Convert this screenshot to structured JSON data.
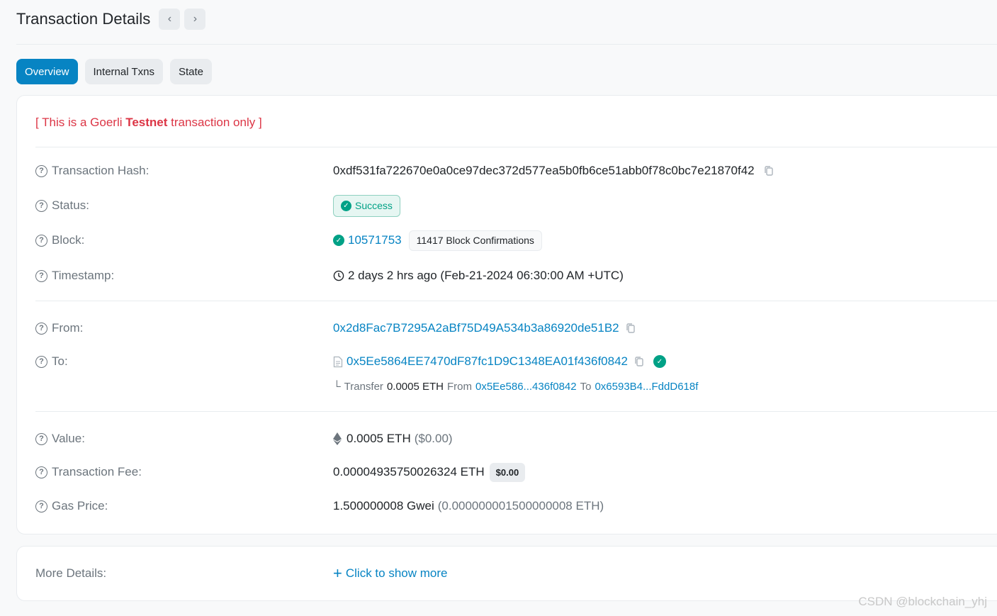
{
  "header": {
    "title": "Transaction Details",
    "prev": "‹",
    "next": "›"
  },
  "tabs": [
    {
      "label": "Overview",
      "active": true
    },
    {
      "label": "Internal Txns",
      "active": false
    },
    {
      "label": "State",
      "active": false
    }
  ],
  "notice": {
    "prefix": "[ This is a Goerli ",
    "bold": "Testnet",
    "suffix": " transaction only ]"
  },
  "details": {
    "hash_label": "Transaction Hash:",
    "hash": "0xdf531fa722670e0a0ce97dec372d577ea5b0fb6ce51abb0f78c0bc7e21870f42",
    "status_label": "Status:",
    "status": "Success",
    "block_label": "Block:",
    "block": "10571753",
    "confirmations": "11417 Block Confirmations",
    "timestamp_label": "Timestamp:",
    "timestamp": "2 days 2 hrs ago (Feb-21-2024 06:30:00 AM +UTC)",
    "from_label": "From:",
    "from": "0x2d8Fac7B7295A2aBf75D49A534b3a86920de51B2",
    "to_label": "To:",
    "to": "0x5Ee5864EE7470dF87fc1D9C1348EA01f436f0842",
    "transfer": {
      "prefix": "Transfer",
      "amount": "0.0005 ETH",
      "from_word": "From",
      "from_addr": "0x5Ee586...436f0842",
      "to_word": "To",
      "to_addr": "0x6593B4...FddD618f"
    },
    "value_label": "Value:",
    "value": "0.0005 ETH",
    "value_usd": "($0.00)",
    "fee_label": "Transaction Fee:",
    "fee": "0.00004935750026324 ETH",
    "fee_usd": "$0.00",
    "gas_label": "Gas Price:",
    "gas": "1.500000008 Gwei",
    "gas_eth": "(0.000000001500000008 ETH)"
  },
  "more": {
    "label": "More Details:",
    "action": "Click to show more"
  },
  "watermark": "CSDN @blockchain_yhj",
  "colors": {
    "primary": "#0784c3",
    "danger": "#dc3545",
    "success": "#00a186",
    "muted": "#6c757d"
  }
}
